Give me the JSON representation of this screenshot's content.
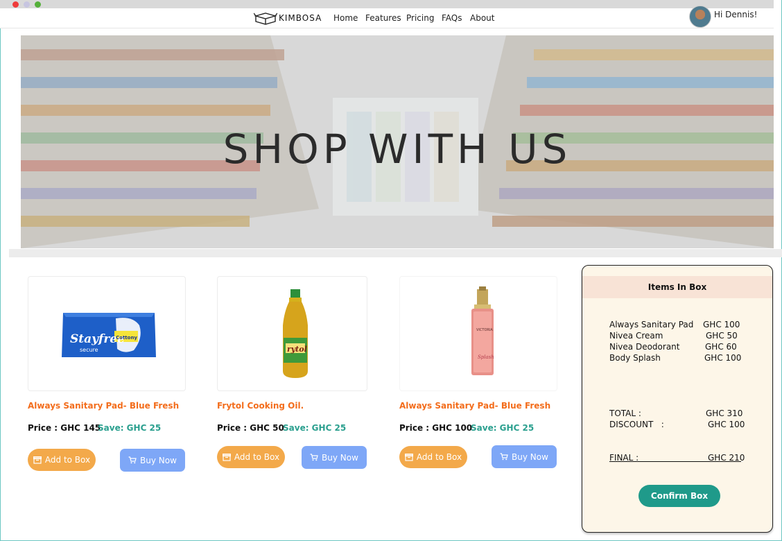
{
  "brand": {
    "name": "KIMBOSA"
  },
  "nav": {
    "links": [
      "Home",
      "Features",
      "Pricing",
      "FAQs",
      "About"
    ]
  },
  "user": {
    "greeting": "Hi Dennis!"
  },
  "hero": {
    "title": "SHOP WITH US"
  },
  "products": [
    {
      "name": "Always Sanitary Pad- Blue Fresh",
      "price": "Price : GHC 145",
      "save": "Save: GHC 25",
      "add_label": "Add to Box",
      "buy_label": "Buy Now",
      "image_label": "Stayfree secure Cottony"
    },
    {
      "name": "Frytol Cooking Oil.",
      "price": "Price : GHC 50",
      "save": "Save: GHC 25",
      "add_label": "Add to Box",
      "buy_label": "Buy Now",
      "image_label": "Frytol"
    },
    {
      "name": "Always Sanitary Pad- Blue Fresh",
      "price": "Price : GHC 100",
      "save": "Save: GHC 25",
      "add_label": "Add to Box",
      "buy_label": "Buy Now",
      "image_label": "Body Splash"
    }
  ],
  "box": {
    "title": "Items In Box",
    "items": [
      {
        "name": "Always Sanitary Pad",
        "price": "GHC 100"
      },
      {
        "name": "Nivea Cream",
        "price": "GHC 50"
      },
      {
        "name": "Nivea Deodorant",
        "price": "GHC 60"
      },
      {
        "name": "Body Splash",
        "price": "GHC 100"
      }
    ],
    "total_label": "TOTAL :",
    "total_value": "GHC 310",
    "discount_label": "DISCOUNT   :",
    "discount_value": "GHC 100",
    "final_label": "FINAL :",
    "final_value": "GHC 210",
    "confirm_label": "Confirm Box"
  },
  "colors": {
    "accent_orange": "#f36d1c",
    "save_green": "#2a9f8e",
    "add_button": "#f3a94a",
    "buy_button": "#7ea7f7",
    "confirm_button": "#1f9a8a",
    "panel_bg": "#fdf6e8"
  },
  "icons": {
    "add": "box-icon",
    "buy": "cart-icon"
  }
}
